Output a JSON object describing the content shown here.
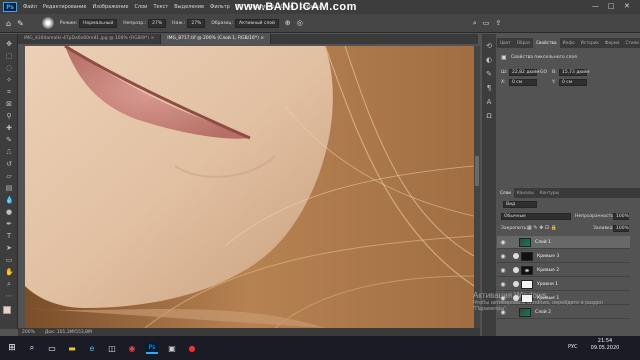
{
  "app": {
    "logo": "Ps",
    "menu": [
      "Файл",
      "Редактирование",
      "Изображение",
      "Слои",
      "Текст",
      "Выделение",
      "Фильтр",
      "3D",
      "Просмотр",
      "Окно",
      "Справка"
    ],
    "recorder_watermark": "www.BANDICAM.com",
    "window_buttons": [
      "—",
      "□",
      "✕"
    ]
  },
  "options": {
    "mode_label": "Режим:",
    "mode_value": "Нормальный",
    "opacity_label": "Непрозр.:",
    "opacity_value": "27%",
    "flow_label": "Наж.:",
    "flow_value": "27%",
    "sample_label": "Образец:",
    "sample_value": "Активный слой"
  },
  "tabs": [
    {
      "label": "IMG_4164amalki-4TpDa6o60m81.jpg @ 100% (RGB/8*) ×",
      "active": false
    },
    {
      "label": "IMG_8717.tif @ 200% (Слой 1, RGB/16*) ×",
      "active": true
    }
  ],
  "status": {
    "zoom": "200%",
    "doc": "Док: 101,3М/553,8М"
  },
  "panel_tabs": [
    "Цвет",
    "Образ",
    "Свойства",
    "Инфо",
    "Историк",
    "Форма",
    "Стили"
  ],
  "properties": {
    "title": "Свойства пиксельного слоя",
    "w_label": "Ш:",
    "w_value": "22,82 дюйм",
    "link_label": "GO",
    "h_label": "В:",
    "h_value": "15,73 дюйм",
    "x_label": "X:",
    "x_value": "0 см",
    "y_label": "Y:",
    "y_value": "0 см"
  },
  "layers_tabs": [
    "Слои",
    "Каналы",
    "Контуры"
  ],
  "layers_controls": {
    "filter_value": "Вид",
    "blend_value": "Обычные",
    "opacity_label": "Непрозрачность:",
    "opacity_value": "100%",
    "lock_label": "Закрепить:",
    "fill_label": "Заливка:",
    "fill_value": "100%"
  },
  "layers": [
    {
      "name": "Слой 1",
      "type": "pixel",
      "selected": true
    },
    {
      "name": "Кривые 3",
      "type": "adjust",
      "selected": false
    },
    {
      "name": "Кривые 2",
      "type": "adjust",
      "selected": false
    },
    {
      "name": "Уровни 1",
      "type": "adjust",
      "selected": false
    },
    {
      "name": "Кривые 1",
      "type": "adjust",
      "selected": false
    },
    {
      "name": "Слой 2",
      "type": "pixel",
      "selected": false
    }
  ],
  "activation": {
    "line1": "Активация Windows",
    "line2": "Чтобы активировать Windows, перейдите в раздел",
    "line3": "\"Параметры\"."
  },
  "taskbar": {
    "lang": "РУС",
    "time": "21:54",
    "date": "09.05.2020"
  },
  "colors": {
    "ps_blue": "#31a8ff",
    "panel_bg": "#535353",
    "dark_bg": "#3d3d3d"
  }
}
